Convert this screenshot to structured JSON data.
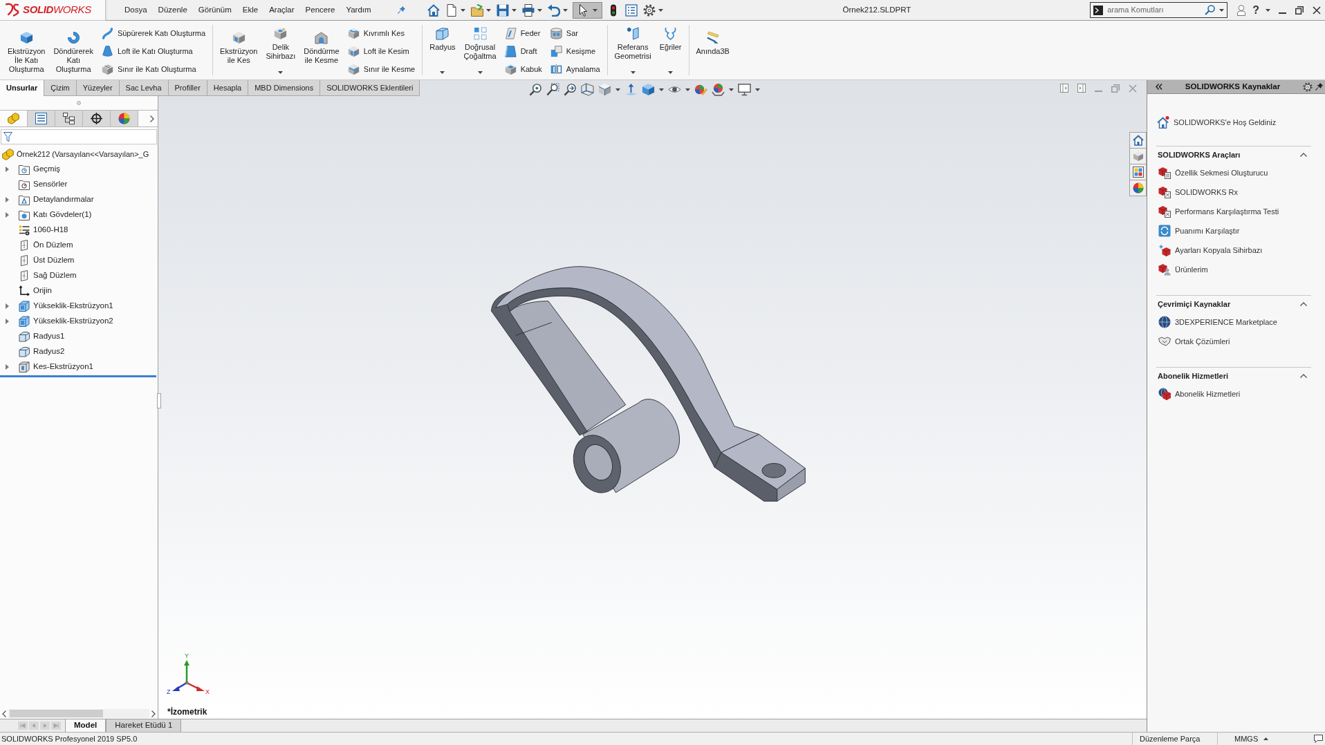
{
  "title_bar": {
    "logo": "**SOLID**WORKS",
    "menu": [
      "Dosya",
      "Düzenle",
      "Görünüm",
      "Ekle",
      "Araçlar",
      "Pencere",
      "Yardım"
    ],
    "quick_access": [
      {
        "dropdown": false,
        "pressed": false
      },
      {
        "dropdown": true,
        "pressed": false
      },
      {
        "dropdown": true,
        "pressed": false
      },
      {
        "dropdown": true,
        "pressed": false
      },
      {
        "dropdown": true,
        "pressed": false
      },
      {
        "dropdown": true,
        "pressed": false
      },
      {
        "dropdown": true,
        "pressed": true
      },
      {
        "dropdown": false,
        "pressed": false
      },
      {
        "dropdown": false,
        "pressed": false
      },
      {
        "dropdown": true,
        "pressed": false
      }
    ],
    "title": "Örnek212.SLDPRT",
    "search": {
      "placeholder": "arama Komutları"
    },
    "help": "?"
  },
  "ribbon": {
    "groups": [
      {
        "items": [
          {
            "kind": "large",
            "label": "Ekstrüzyon\nİle Katı\nOluşturma"
          },
          {
            "kind": "large",
            "label": "Döndürerek\nKatı\nOluşturma"
          },
          {
            "kind": "stack",
            "items": [
              "Süpürerek Katı Oluşturma",
              "Loft ile Katı Oluşturma",
              "Sınır ile Katı Oluşturma"
            ]
          }
        ]
      },
      {
        "items": [
          {
            "kind": "large",
            "label": "Ekstrüzyon\nile Kes"
          },
          {
            "kind": "large",
            "label": "Delik\nSihirbazı",
            "dropdown": true
          },
          {
            "kind": "large",
            "label": "Döndürme\nile Kesme"
          },
          {
            "kind": "stack",
            "items": [
              "Kıvrımlı Kes",
              "Loft ile Kesim",
              "Sınır ile Kesme"
            ]
          }
        ]
      },
      {
        "items": [
          {
            "kind": "large",
            "label": "Radyus",
            "dropdown": true
          },
          {
            "kind": "large",
            "label": "Doğrusal\nÇoğaltma",
            "dropdown": true
          },
          {
            "kind": "stack",
            "items": [
              "Feder",
              "Draft",
              "Kabuk"
            ]
          },
          {
            "kind": "stack",
            "items": [
              "Sar",
              "Kesişme",
              "Aynalama"
            ]
          }
        ]
      },
      {
        "items": [
          {
            "kind": "large",
            "label": "Referans\nGeometrisi",
            "dropdown": true
          },
          {
            "kind": "large",
            "label": "Eğriler",
            "dropdown": true
          }
        ]
      },
      {
        "items": [
          {
            "kind": "large",
            "label": "Anında3B"
          }
        ]
      }
    ],
    "tabs": [
      {
        "label": "Unsurlar",
        "selected": true
      },
      {
        "label": "Çizim",
        "selected": false
      },
      {
        "label": "Yüzeyler",
        "selected": false
      },
      {
        "label": "Sac Levha",
        "selected": false
      },
      {
        "label": "Profiller",
        "selected": false
      },
      {
        "label": "Hesapla",
        "selected": false
      },
      {
        "label": "MBD Dimensions",
        "selected": false
      },
      {
        "label": "SOLIDWORKS Eklentileri",
        "selected": false
      }
    ]
  },
  "view_toolbar": [
    {
      "dropdown": false
    },
    {
      "dropdown": false
    },
    {
      "dropdown": false
    },
    {
      "dropdown": false
    },
    {
      "dropdown": true
    },
    {
      "dropdown": false
    },
    {
      "dropdown": true
    },
    {
      "dropdown": true
    },
    {
      "dropdown": false
    },
    {
      "dropdown": true
    },
    {
      "dropdown": true
    }
  ],
  "feature_manager": {
    "tabs": [
      {
        "selected": true
      },
      {
        "selected": false
      },
      {
        "selected": false
      },
      {
        "selected": false
      },
      {
        "selected": false
      }
    ],
    "root": "Örnek212 (Varsayılan<<Varsayılan>_G",
    "items": [
      {
        "label": "Geçmiş",
        "kind": "history",
        "expanded": false
      },
      {
        "label": "Sensörler",
        "kind": "sensors"
      },
      {
        "label": "Detaylandırmalar",
        "kind": "annotations",
        "expanded": false
      },
      {
        "label": "Katı Gövdeler(1)",
        "kind": "bodies",
        "expanded": false
      },
      {
        "label": "1060-H18",
        "kind": "material"
      },
      {
        "label": "Ön Düzlem",
        "kind": "plane"
      },
      {
        "label": "Üst Düzlem",
        "kind": "plane"
      },
      {
        "label": "Sağ Düzlem",
        "kind": "plane"
      },
      {
        "label": "Orijin",
        "kind": "origin"
      },
      {
        "label": "Yükseklik-Ekstrüzyon1",
        "kind": "extrude",
        "expanded": false
      },
      {
        "label": "Yükseklik-Ekstrüzyon2",
        "kind": "extrude",
        "expanded": false
      },
      {
        "label": "Radyus1",
        "kind": "fillet"
      },
      {
        "label": "Radyus2",
        "kind": "fillet"
      },
      {
        "label": "Kes-Ekstrüzyon1",
        "kind": "cut",
        "expanded": false
      }
    ]
  },
  "viewport": {
    "view_label": "*İzometrik",
    "triad": {
      "x": "X",
      "y": "Y",
      "z": "Z"
    }
  },
  "model_tabs": [
    {
      "label": "Model",
      "selected": true
    },
    {
      "label": "Hareket Etüdü 1",
      "selected": false
    }
  ],
  "task_pane": {
    "title": "SOLIDWORKS Kaynaklar",
    "welcome": "SOLIDWORKS'e Hoş Geldiniz",
    "sections": [
      {
        "title": "SOLIDWORKS Araçları",
        "expanded": true,
        "items": [
          {
            "label": "Özellik Sekmesi Oluşturucu",
            "kind": "tabbuilder"
          },
          {
            "label": "SOLIDWORKS Rx",
            "kind": "rx"
          },
          {
            "label": "Performans Karşılaştırma Testi",
            "kind": "benchmark"
          },
          {
            "label": "Puanımı Karşılaştır",
            "kind": "compare"
          },
          {
            "label": "Ayarları Kopyala Sihirbazı",
            "kind": "wizard"
          },
          {
            "label": "Ürünlerim",
            "kind": "products"
          }
        ]
      },
      {
        "title": "Çevrimiçi Kaynaklar",
        "expanded": true,
        "items": [
          {
            "label": "3DEXPERIENCE Marketplace",
            "kind": "marketplace"
          },
          {
            "label": "Ortak Çözümleri",
            "kind": "partners"
          }
        ]
      },
      {
        "title": "Abonelik Hizmetleri",
        "expanded": true,
        "items": [
          {
            "label": "Abonelik Hizmetleri",
            "kind": "subscription"
          }
        ]
      }
    ]
  },
  "status_bar": {
    "version": "SOLIDWORKS Profesyonel 2019 SP5.0",
    "mode": "Düzenleme Parça",
    "units": "MMGS"
  }
}
